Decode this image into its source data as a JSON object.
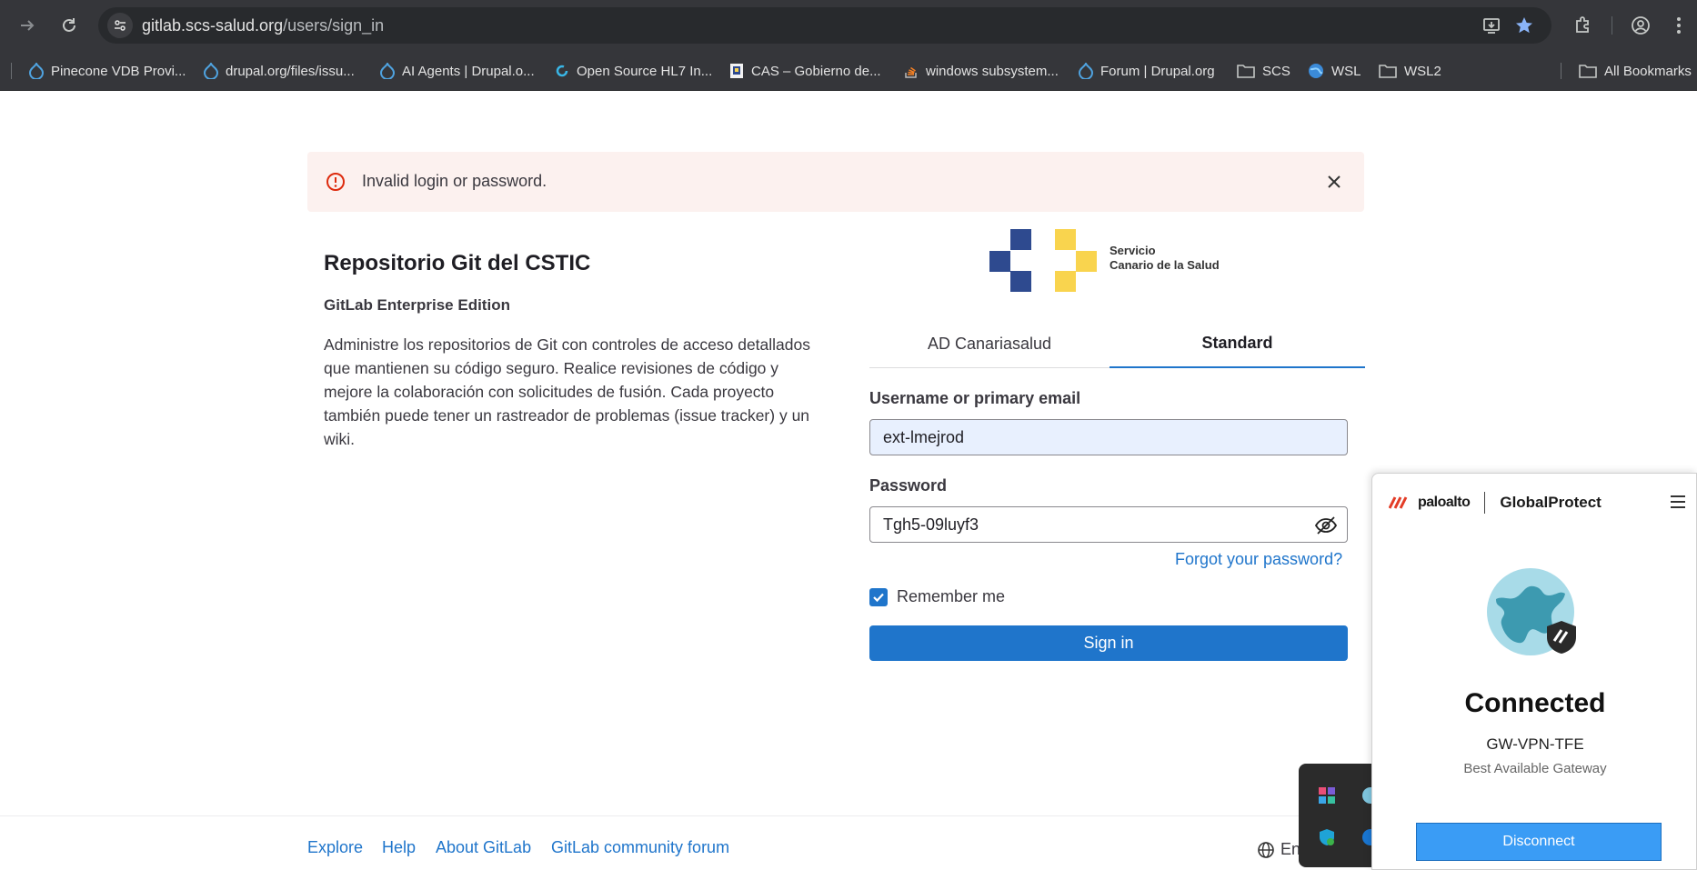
{
  "browser": {
    "url_host": "gitlab.scs-salud.org",
    "url_path": "/users/sign_in",
    "bookmarks": [
      {
        "label": "Pinecone VDB Provi...",
        "icon": "drupal-icon"
      },
      {
        "label": "drupal.org/files/issu...",
        "icon": "drupal-icon"
      },
      {
        "label": "AI Agents | Drupal.o...",
        "icon": "drupal-icon"
      },
      {
        "label": "Open Source HL7 In...",
        "icon": "loop-icon"
      },
      {
        "label": "CAS – Gobierno de...",
        "icon": "coat-of-arms-icon"
      },
      {
        "label": "windows subsystem...",
        "icon": "stackoverflow-icon"
      },
      {
        "label": "Forum | Drupal.org",
        "icon": "drupal-icon"
      },
      {
        "label": "SCS",
        "icon": "folder-icon"
      },
      {
        "label": "WSL",
        "icon": "globe-icon"
      },
      {
        "label": "WSL2",
        "icon": "folder-icon"
      }
    ],
    "all_bookmarks": "All Bookmarks"
  },
  "alert": {
    "message": "Invalid login or password."
  },
  "intro": {
    "title": "Repositorio Git del CSTIC",
    "edition": "GitLab Enterprise Edition",
    "description": "Administre los repositorios de Git con controles de acceso detallados que mantienen su código seguro. Realice revisiones de código y mejore la colaboración con solicitudes de fusión. Cada proyecto también puede tener un rastreador de problemas (issue tracker) y un wiki."
  },
  "logo": {
    "line1": "Servicio",
    "line2": "Canario de la Salud",
    "colors": {
      "blue": "#2e4a8f",
      "yellow": "#f9d44e"
    }
  },
  "tabs": [
    {
      "label": "AD Canariasalud",
      "active": false
    },
    {
      "label": "Standard",
      "active": true
    }
  ],
  "form": {
    "username_label": "Username or primary email",
    "username_value": "ext-lmejrod",
    "password_label": "Password",
    "password_value": "Tgh5-09luyf3",
    "forgot_label": "Forgot your password?",
    "remember_label": "Remember me",
    "remember_checked": true,
    "signin_label": "Sign in"
  },
  "footer": {
    "links": [
      "Explore",
      "Help",
      "About GitLab",
      "GitLab community forum"
    ],
    "language": "En"
  },
  "globalprotect": {
    "brand": "paloalto",
    "product": "GlobalProtect",
    "status": "Connected",
    "gateway": "GW-VPN-TFE",
    "gateway_sub": "Best Available Gateway",
    "disconnect_label": "Disconnect"
  },
  "colors": {
    "accent": "#1f75cb",
    "alert_bg": "#fcf1ef",
    "alert_icon": "#dd2b0e",
    "chrome_bg": "#35363a",
    "gp_button": "#3a9cf5"
  }
}
